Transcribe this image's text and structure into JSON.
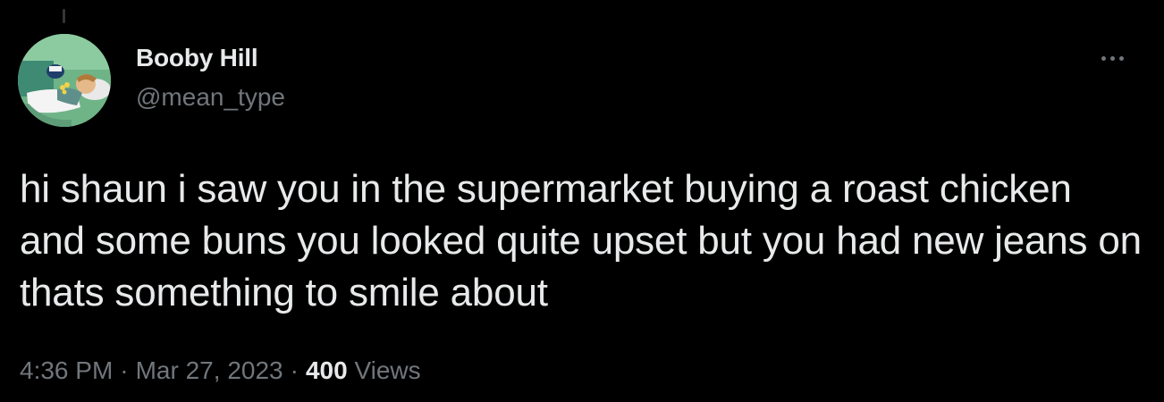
{
  "author": {
    "display_name": "Booby Hill",
    "handle": "@mean_type",
    "avatar_icon": "cartoon-avatar-icon"
  },
  "tweet": {
    "text": "hi shaun i saw you in the supermarket buying a roast chicken and some buns you looked quite upset but you had new jeans on thats something to smile about"
  },
  "meta": {
    "time": "4:36 PM",
    "separator": "·",
    "date": "Mar 27, 2023",
    "views_count": "400",
    "views_label": "Views"
  },
  "colors": {
    "background": "#000000",
    "primary_text": "#e7e9ea",
    "secondary_text": "#71767b"
  },
  "icons": {
    "more": "more-options-icon"
  }
}
